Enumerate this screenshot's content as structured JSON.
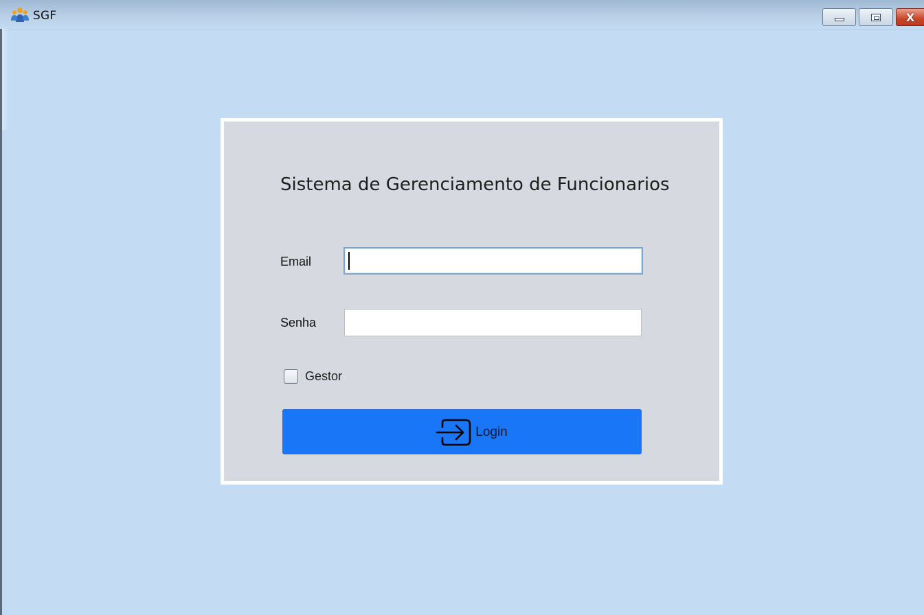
{
  "window": {
    "title": "SGF",
    "app_icon": "people-icon",
    "controls": {
      "minimize_icon": "minimize-icon",
      "maximize_icon": "maximize-icon",
      "close_glyph": "X"
    }
  },
  "login": {
    "heading": "Sistema de Gerenciamento de Funcionarios",
    "email_label": "Email",
    "email_value": "",
    "password_label": "Senha",
    "password_value": "",
    "gestor_label": "Gestor",
    "gestor_checked": false,
    "button_label": "Login",
    "button_icon": "login-enter-icon"
  },
  "colors": {
    "background": "#c3dcf3",
    "card": "#d6d9e0",
    "card_border": "#ffffff",
    "button": "#1976f7",
    "close_button": "#c8452a"
  }
}
